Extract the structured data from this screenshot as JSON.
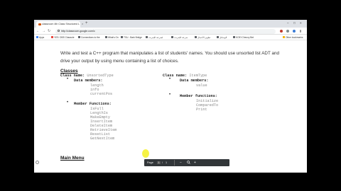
{
  "browser": {
    "tab_title": "classroom 4th Class Structured L",
    "tab_close": "×",
    "new_tab": "+",
    "address": "http://classroom.google.com/c",
    "window_controls": [
      "–",
      "□",
      "×"
    ],
    "nav": [
      "←",
      "→",
      "↻"
    ],
    "bookmarks": [
      {
        "label": "Apps",
        "color": "#4285f4"
      },
      {
        "label": "YES: DBS Characte",
        "color": "#e8453c"
      },
      {
        "label": "Connections to the",
        "color": "#5f6368"
      },
      {
        "label": "What's On",
        "color": "#5f6368"
      },
      {
        "label": "TSU - Bark Bridge",
        "color": "#5f6368"
      },
      {
        "label": "لسرعة الإنترنت",
        "color": "#5f6368"
      },
      {
        "label": "سرعة الإنترنت",
        "color": "#5f6368"
      },
      {
        "label": "تطوير الأعمال",
        "color": "#5f6368"
      },
      {
        "label": "الوسائل",
        "color": "#5f6368"
      },
      {
        "label": "KOEI Cheuvy Bet",
        "color": "#5f6368"
      },
      {
        "label": "Other bookmarks",
        "color": "#f4b400"
      }
    ]
  },
  "doc": {
    "intro": "Write and test a C++ program that manipulates a list of students' names. You should use unsorted list ADT and drive your output by using menu containing a list of choices.",
    "classes_heading": "Classes",
    "left": {
      "class_label": "Class name:",
      "class_value": "UnsortedType",
      "members_label": "Data members:",
      "members": [
        "length",
        "info",
        "currentPos"
      ],
      "functions_label": "Member Functions:",
      "functions": [
        "IsFull",
        "LengthIs",
        "MakeEmpty",
        "InsertItem",
        "DeleteItem",
        "RetrieveItem",
        "ResetList",
        "GetNextItem"
      ]
    },
    "right": {
      "class_label": "Class name:",
      "class_value": "ItemType",
      "members_label": "Data members:",
      "members": [
        "value"
      ],
      "functions_label": "Member functions:",
      "functions": [
        "Initialize",
        "ComparedTo",
        "Print"
      ]
    },
    "main_menu_heading": "Main Menu"
  },
  "pdf_controls": {
    "page_label": "Page",
    "page_current": "1",
    "page_sep": "/",
    "page_total": "1",
    "zoom_out": "−",
    "zoom_in": "+",
    "search_icon": "search-icon"
  }
}
